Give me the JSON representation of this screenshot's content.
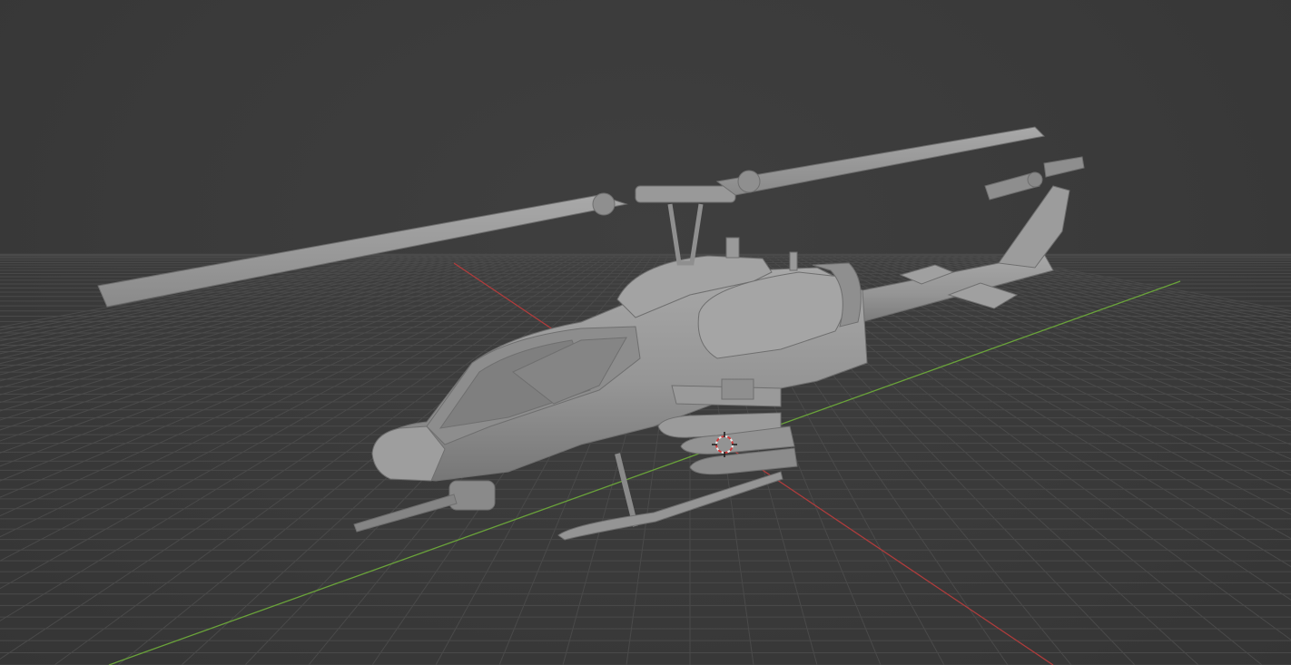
{
  "viewport": {
    "background_color": "#3a3a3a",
    "grid_color": "#4a4a4a",
    "x_axis_color": "#b03c3c",
    "y_axis_color": "#6aa33a"
  },
  "scene": {
    "model": "helicopter-mesh",
    "model_color": "#9a9a9a",
    "cursor": "3d-cursor-icon"
  }
}
